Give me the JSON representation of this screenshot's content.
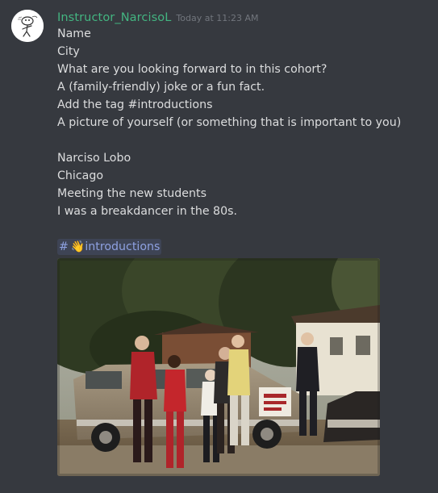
{
  "message": {
    "username": "Instructor_NarcisoL",
    "timestamp": "Today at 11:23 AM",
    "username_color": "#43b581",
    "lines": [
      "Name",
      "City",
      "What are you looking forward to in this cohort?",
      "A (family-friendly) joke or a fun fact.",
      "Add the tag #introductions",
      "A picture of yourself (or something that is important to you)",
      "",
      "Narciso Lobo",
      "Chicago",
      "Meeting the new students",
      "I was a breakdancer in the 80s."
    ],
    "channel_mention": {
      "hash": "#",
      "emoji": "👋",
      "name": "introductions"
    },
    "attachment": {
      "type": "photo",
      "icon": "photo-image",
      "van_sign": "SAN BOMA STREET ROCKERS"
    }
  },
  "colors": {
    "background": "#36393f",
    "text": "#dcddde",
    "timestamp": "#72767d",
    "mention_text": "#8ea1e1"
  }
}
